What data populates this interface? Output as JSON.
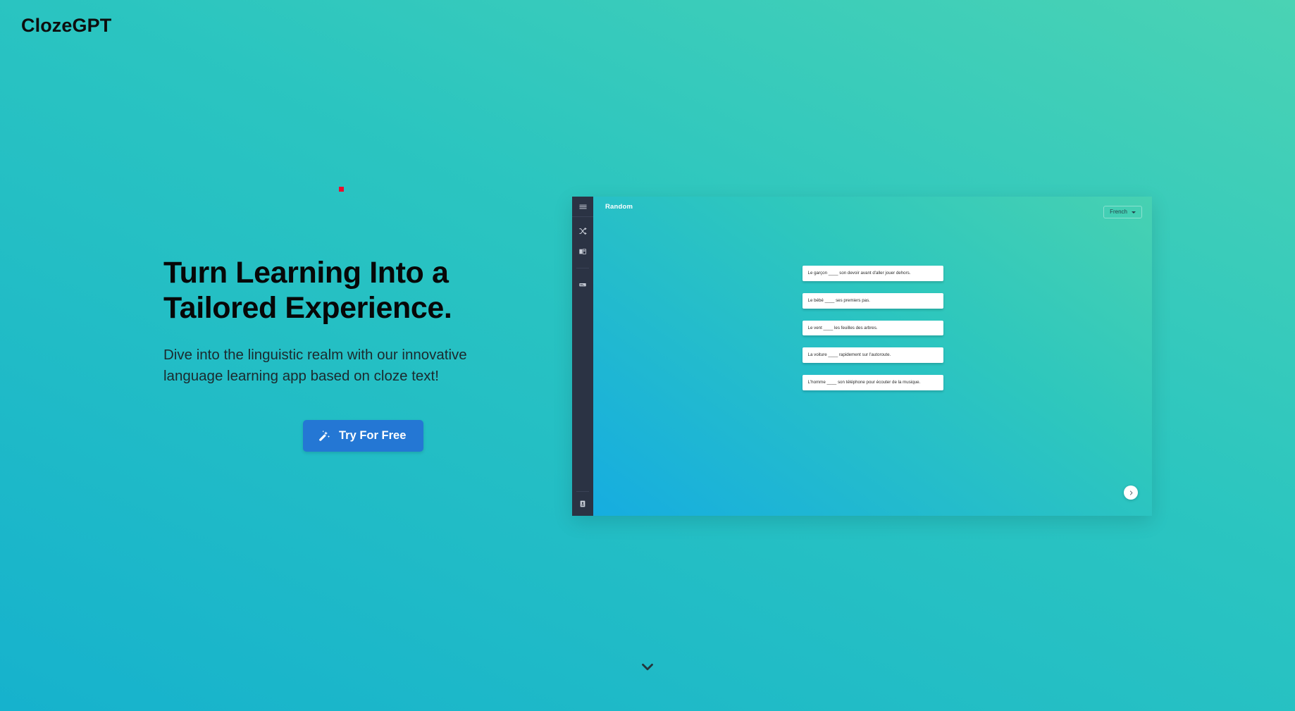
{
  "brand": {
    "name": "ClozeGPT"
  },
  "hero": {
    "title_line1": "Turn Learning Into a",
    "title_line2": "Tailored Experience.",
    "subtitle_line1": "Dive into the linguistic realm with our innovative",
    "subtitle_line2": "language learning app based on cloze text!",
    "cta_label": "Try For Free",
    "cta_icon": "magic-wand-icon",
    "cta_color": "#2477d4"
  },
  "decor": {
    "red_square_color": "#e8102f"
  },
  "mockup": {
    "title": "Random",
    "sidebar": {
      "menu_icon": "hamburger-menu-icon",
      "items": [
        {
          "icon": "shuffle-icon",
          "name": "shuffle"
        },
        {
          "icon": "book-open-icon",
          "name": "library"
        },
        {
          "icon": "flashcard-icon",
          "name": "flashcards"
        }
      ],
      "bottom_item": {
        "icon": "account-card-icon",
        "name": "account"
      }
    },
    "language_select": {
      "value": "French",
      "caret_icon": "chevron-down-icon",
      "options": [
        "French"
      ]
    },
    "cards": [
      "Le garçon ____ son devoir avant d'aller jouer dehors.",
      "Le bébé ____ ses premiers pas.",
      "Le vent ____ les feuilles des arbres.",
      "La voiture ____ rapidement sur l'autoroute.",
      "L'homme ____ son téléphone pour écouter de la musique."
    ],
    "next_button_icon": "chevron-right-icon",
    "gradient_from": "#47d1b2",
    "gradient_to": "#16ade0",
    "sidebar_color": "#2b3344"
  },
  "footer": {
    "scroll_hint_icon": "chevron-down-icon"
  },
  "theme": {
    "background_from": "#4ad3b4",
    "background_to": "#16b2cd"
  }
}
